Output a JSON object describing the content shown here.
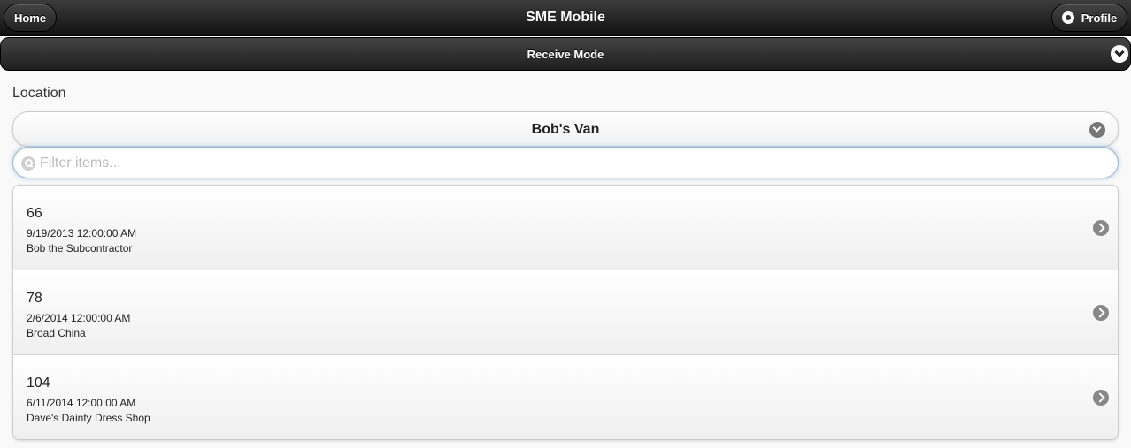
{
  "header": {
    "title": "SME Mobile",
    "home_label": "Home",
    "profile_label": "Profile",
    "profile_icon": "gear-icon"
  },
  "mode": {
    "label": "Receive Mode",
    "icon": "chevron-down-icon"
  },
  "location": {
    "label": "Location",
    "selected": "Bob's Van",
    "icon": "chevron-down-icon"
  },
  "filter": {
    "placeholder": "Filter items...",
    "value": "",
    "icon": "search-icon"
  },
  "items": [
    {
      "number": "66",
      "date": "9/19/2013 12:00:00 AM",
      "name": "Bob the Subcontractor"
    },
    {
      "number": "78",
      "date": "2/6/2014 12:00:00 AM",
      "name": "Broad China"
    },
    {
      "number": "104",
      "date": "6/11/2014 12:00:00 AM",
      "name": "Dave's Dainty Dress Shop"
    }
  ],
  "colors": {
    "header_bg": "#1e1e1e",
    "page_bg": "#f9f9f9",
    "focus_glow": "#a8c6e2"
  }
}
